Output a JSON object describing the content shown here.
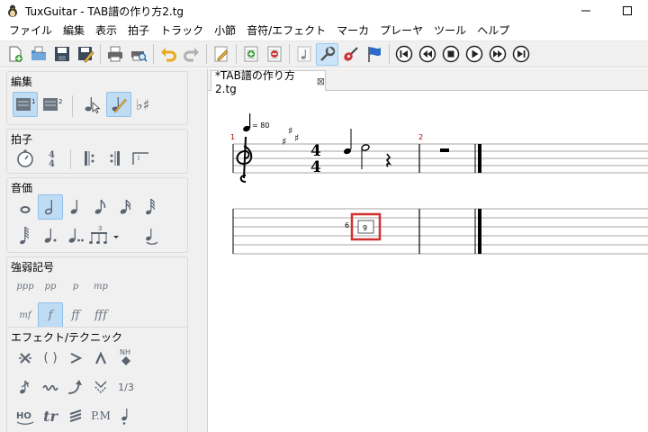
{
  "window": {
    "title": "TuxGuitar - TAB譜の作り方2.tg"
  },
  "menu": [
    "ファイル",
    "編集",
    "表示",
    "拍子",
    "トラック",
    "小節",
    "音符/エフェクト",
    "マーカ",
    "プレーヤ",
    "ツール",
    "ヘルプ"
  ],
  "toolbar": {
    "buttons": [
      {
        "icon": "new-file-icon"
      },
      {
        "icon": "open-folder-icon"
      },
      {
        "icon": "save-icon"
      },
      {
        "icon": "save-as-icon"
      },
      {
        "icon": "print-icon"
      },
      {
        "icon": "print-preview-icon"
      },
      {
        "icon": "undo-icon"
      },
      {
        "icon": "redo-icon"
      },
      {
        "icon": "edit-pencil-icon"
      },
      {
        "icon": "add-measure-icon"
      },
      {
        "icon": "remove-measure-icon"
      },
      {
        "icon": "note-view-icon"
      },
      {
        "icon": "tools-icon",
        "active": true
      },
      {
        "icon": "guitar-icon"
      },
      {
        "icon": "flag-icon"
      },
      {
        "icon": "first-icon"
      },
      {
        "icon": "previous-icon"
      },
      {
        "icon": "stop-icon"
      },
      {
        "icon": "play-icon"
      },
      {
        "icon": "next-icon"
      },
      {
        "icon": "last-icon"
      }
    ]
  },
  "panel": {
    "groups": {
      "edit": "編集",
      "time_signature": "拍子",
      "duration": "音価",
      "dynamics": "強弱記号",
      "effects": "エフェクト/テクニック"
    },
    "edit_number_labels": [
      "1",
      "2"
    ],
    "dynamics_row1": [
      "ppp",
      "pp",
      "p",
      "mp"
    ],
    "dynamics_row2": [
      "mf",
      "f",
      "ff",
      "fff"
    ],
    "time_sig_label": "4/4",
    "tuplet_label": "3",
    "effects_labels": {
      "ghost": "( )",
      "harmonic": "NH",
      "tremolo_fraction": "1/3",
      "hammer": "HO",
      "trill": "tr",
      "palm_mute": "P.M"
    }
  },
  "editor": {
    "tab_title": "*TAB譜の作り方2.tg",
    "tab_close": "⊠",
    "score": {
      "tempo": "= 80",
      "measure_numbers": [
        "1",
        "2"
      ],
      "time_signature": {
        "numerator": "4",
        "denominator": "4"
      },
      "key_signature": "3 sharps",
      "string_label": "6",
      "fret_value": "9"
    }
  },
  "colors": {
    "accent_active": "#bfdcf5",
    "selection_box": "#d32f2f",
    "measure_number": "#b00000"
  }
}
